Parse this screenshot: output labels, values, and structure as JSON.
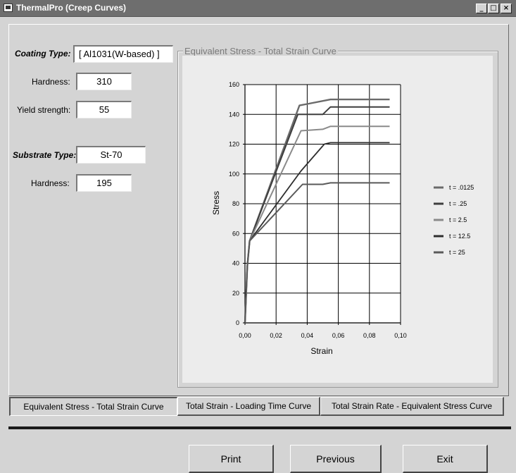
{
  "window": {
    "title": "ThermalPro (Creep Curves)",
    "controls": {
      "minimize": "_",
      "maximize": "□",
      "close": "×"
    }
  },
  "coating": {
    "type_label": "Coating Type:",
    "type_value": "[ Al1031(W-based) ]",
    "hardness_label": "Hardness:",
    "hardness_value": "310",
    "yield_label": "Yield strength:",
    "yield_value": "55"
  },
  "substrate": {
    "type_label": "Substrate Type:",
    "type_value": "St-70",
    "hardness_label": "Hardness:",
    "hardness_value": "195"
  },
  "chart_group": {
    "title": "Equivalent Stress -  Total Strain Curve"
  },
  "chart_data": {
    "type": "line",
    "title": "",
    "xlabel": "Strain",
    "ylabel": "Stress",
    "xlim": [
      0,
      0.1
    ],
    "ylim": [
      0,
      160
    ],
    "x_ticks": [
      "0,00",
      "0,02",
      "0,04",
      "0,06",
      "0,08",
      "0,10"
    ],
    "y_ticks": [
      "0",
      "20",
      "40",
      "60",
      "80",
      "100",
      "120",
      "140",
      "160"
    ],
    "grid": true,
    "legend_position": "right",
    "series": [
      {
        "name": "t = .0125",
        "color": "#6a6a6a",
        "width": 2.4,
        "points": [
          [
            0,
            0
          ],
          [
            0.0015,
            38
          ],
          [
            0.003,
            55
          ],
          [
            0.035,
            146
          ],
          [
            0.04,
            147
          ],
          [
            0.055,
            150
          ],
          [
            0.093,
            150
          ]
        ]
      },
      {
        "name": "t = .25",
        "color": "#3e3e3e",
        "width": 2.0,
        "points": [
          [
            0,
            0
          ],
          [
            0.0015,
            38
          ],
          [
            0.003,
            55
          ],
          [
            0.034,
            140
          ],
          [
            0.05,
            140
          ],
          [
            0.055,
            145
          ],
          [
            0.093,
            145
          ]
        ]
      },
      {
        "name": "t = 2.5",
        "color": "#8a8a8a",
        "width": 2.0,
        "points": [
          [
            0,
            0
          ],
          [
            0.0015,
            38
          ],
          [
            0.003,
            55
          ],
          [
            0.036,
            129
          ],
          [
            0.05,
            130
          ],
          [
            0.055,
            132
          ],
          [
            0.093,
            132
          ]
        ]
      },
      {
        "name": "t = 12.5",
        "color": "#2e2e2e",
        "width": 1.8,
        "points": [
          [
            0,
            0
          ],
          [
            0.0015,
            38
          ],
          [
            0.003,
            55
          ],
          [
            0.036,
            102
          ],
          [
            0.051,
            120
          ],
          [
            0.055,
            121
          ],
          [
            0.093,
            121
          ]
        ]
      },
      {
        "name": "t = 25",
        "color": "#5a5a5a",
        "width": 2.0,
        "points": [
          [
            0,
            0
          ],
          [
            0.0015,
            38
          ],
          [
            0.003,
            55
          ],
          [
            0.037,
            93
          ],
          [
            0.05,
            93
          ],
          [
            0.055,
            94
          ],
          [
            0.093,
            94
          ]
        ]
      }
    ]
  },
  "tabs": [
    "Equivalent Stress - Total Strain Curve",
    "Total Strain - Loading Time Curve",
    "Total Strain Rate - Equivalent Stress Curve"
  ],
  "buttons": {
    "print": "Print",
    "previous": "Previous",
    "exit": "Exit"
  }
}
